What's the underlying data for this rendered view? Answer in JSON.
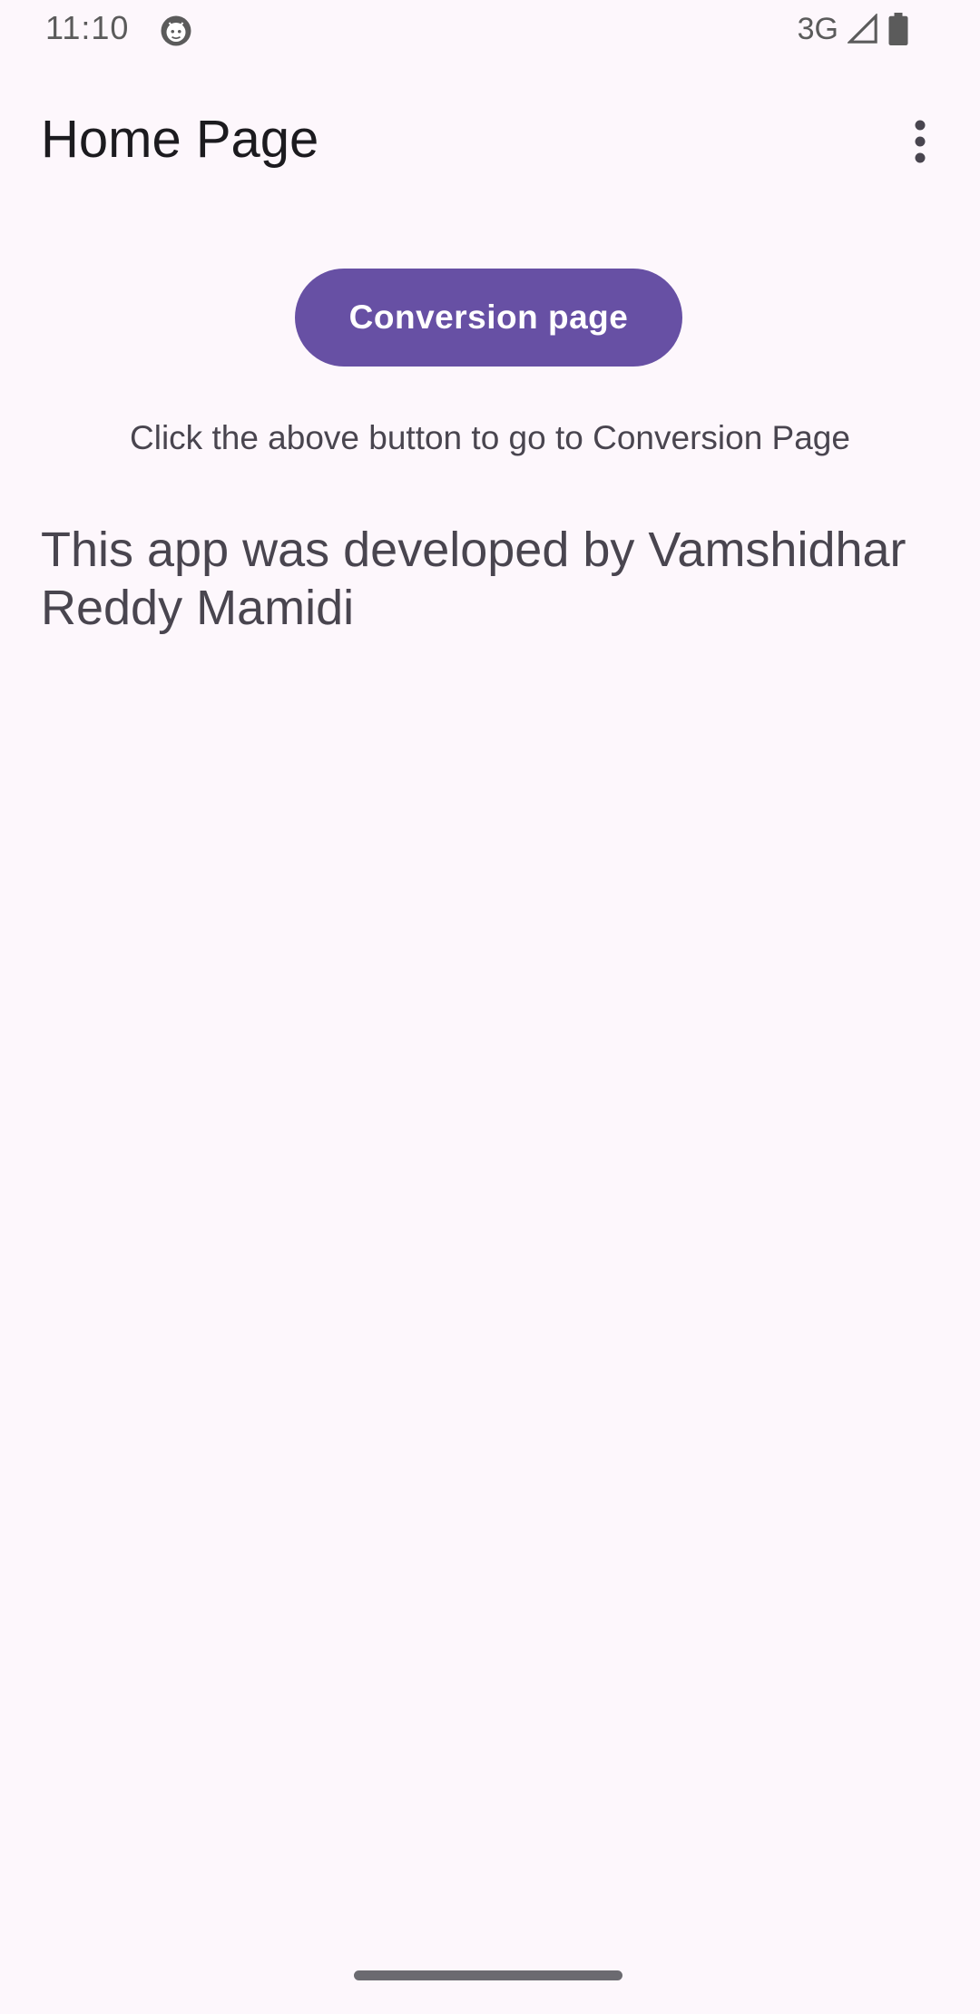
{
  "status_bar": {
    "time": "11:10",
    "network": "3G",
    "app_icon": "android-debug-icon",
    "signal_icon": "cell-signal-icon",
    "battery_icon": "battery-icon"
  },
  "app_bar": {
    "title": "Home Page",
    "menu_icon": "more-vert-icon"
  },
  "main": {
    "conversion_button_label": "Conversion page",
    "hint": "Click the above button to go to Conversion Page",
    "developer_note": "This app was developed by Vamshidhar Reddy Mamidi"
  },
  "colors": {
    "background": "#fdf7fc",
    "primary": "#6750a4",
    "on_primary": "#ffffff",
    "text_primary": "#1c1b1f",
    "text_secondary": "#49454f"
  }
}
